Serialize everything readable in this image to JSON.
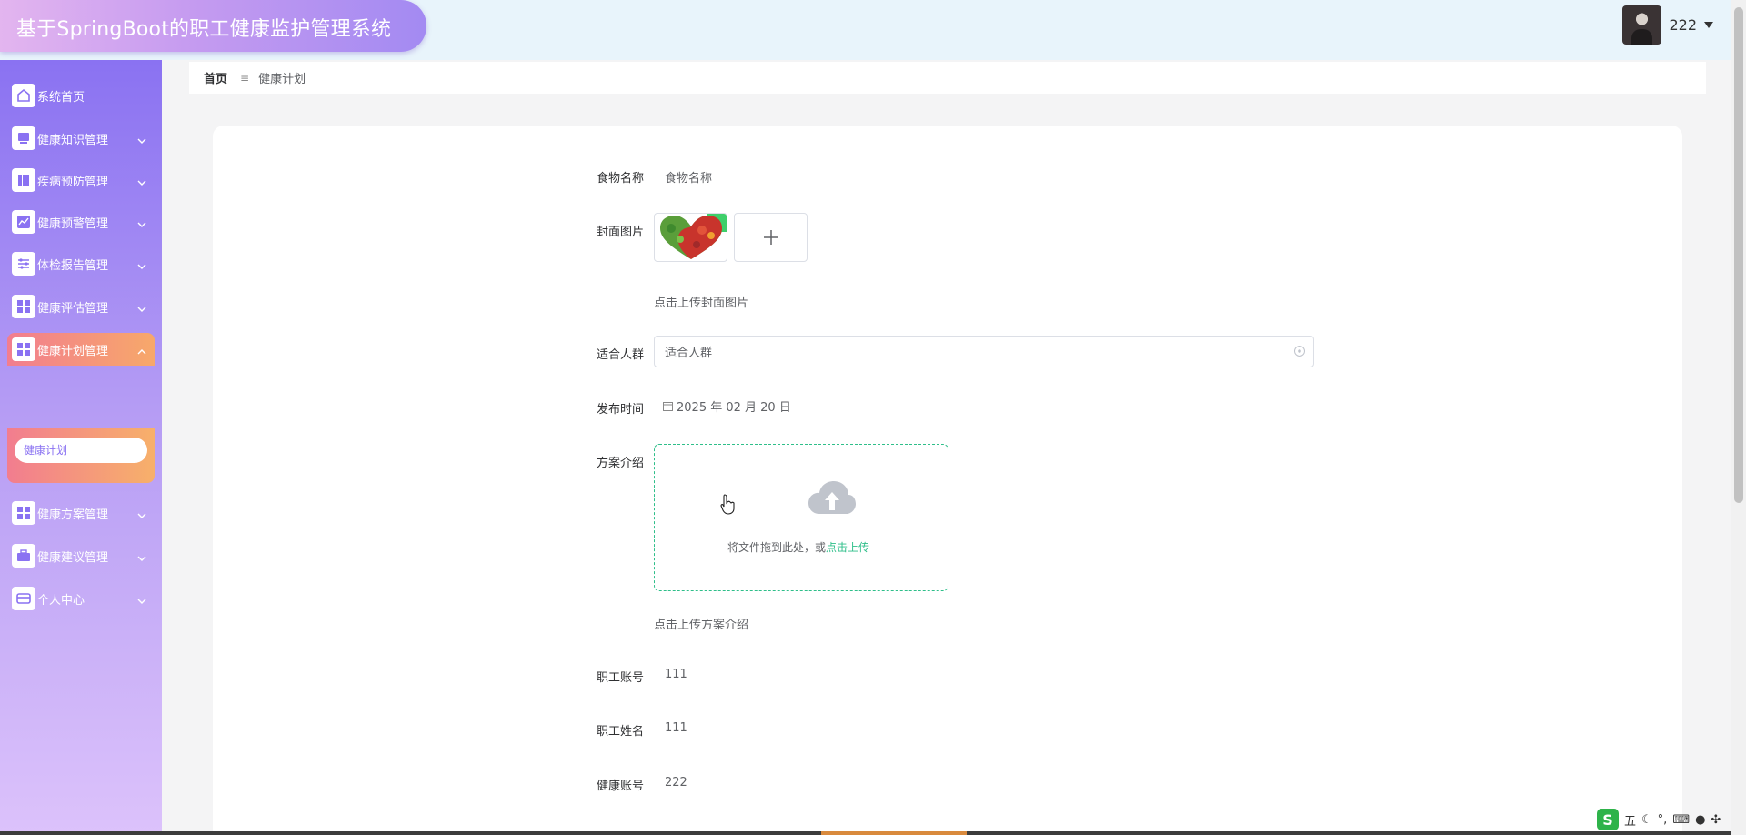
{
  "app": {
    "title": "基于SpringBoot的职工健康监护管理系统"
  },
  "user": {
    "name": "222"
  },
  "sidebar": {
    "items": [
      {
        "label": "系统首页",
        "icon": "home-icon"
      },
      {
        "label": "健康知识管理",
        "icon": "monitor-icon"
      },
      {
        "label": "疾病预防管理",
        "icon": "book-icon"
      },
      {
        "label": "健康预警管理",
        "icon": "chart-icon"
      },
      {
        "label": "体检报告管理",
        "icon": "sliders-icon"
      },
      {
        "label": "健康评估管理",
        "icon": "grid-icon"
      },
      {
        "label": "健康计划管理",
        "icon": "grid-icon"
      },
      {
        "label": "健康方案管理",
        "icon": "grid-icon"
      },
      {
        "label": "健康建议管理",
        "icon": "briefcase-icon"
      },
      {
        "label": "个人中心",
        "icon": "card-icon"
      }
    ],
    "submenu": {
      "label": "健康计划"
    }
  },
  "breadcrumb": {
    "home": "首页",
    "separator": "≡",
    "current": "健康计划"
  },
  "form": {
    "food_name": {
      "label": "食物名称",
      "value": "食物名称"
    },
    "cover": {
      "label": "封面图片",
      "hint": "点击上传封面图片"
    },
    "audience": {
      "label": "适合人群",
      "value": "适合人群"
    },
    "publish_time": {
      "label": "发布时间",
      "value": "2025 年 02 月 20 日"
    },
    "plan_intro": {
      "label": "方案介绍",
      "drop_text": "将文件拖到此处，或",
      "drop_link": "点击上传",
      "hint": "点击上传方案介绍"
    },
    "employee_account": {
      "label": "职工账号",
      "value": "111"
    },
    "employee_name": {
      "label": "职工姓名",
      "value": "111"
    },
    "health_account": {
      "label": "健康账号",
      "value": "222"
    }
  },
  "ime": {
    "logo": "S",
    "mode": "五"
  },
  "colors": {
    "accent_green": "#2fbf8a",
    "sidebar_top": "#8a72f2",
    "active_item": "#f27d8f"
  }
}
